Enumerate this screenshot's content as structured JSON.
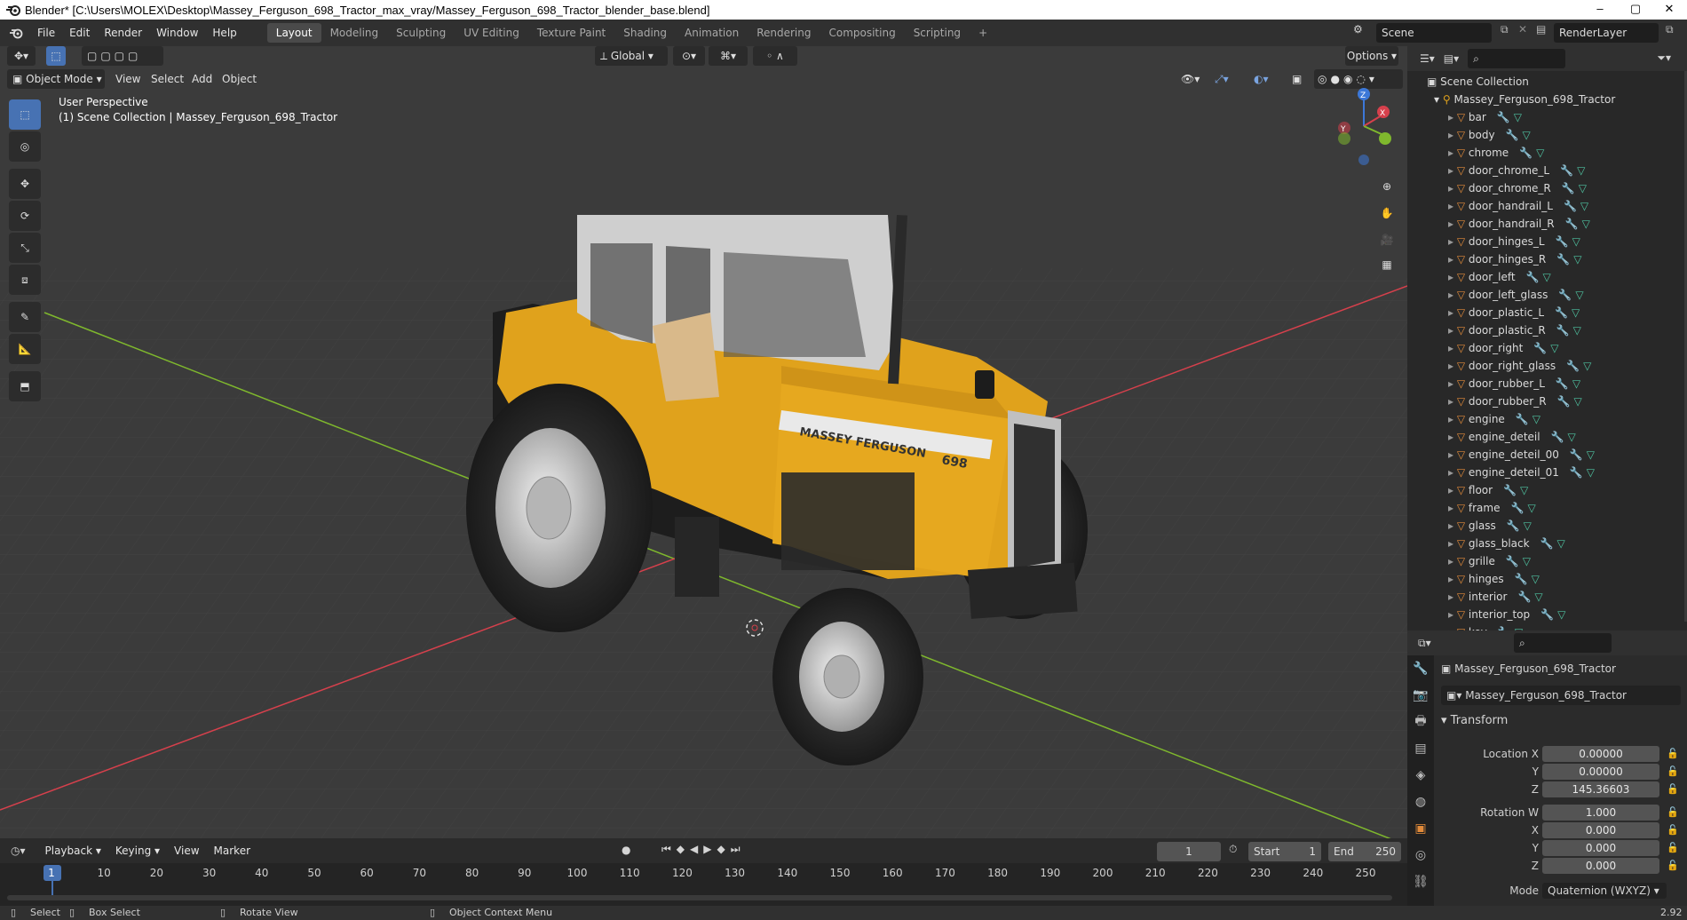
{
  "window": {
    "title": "Blender* [C:\\Users\\MOLEX\\Desktop\\Massey_Ferguson_698_Tractor_max_vray/Massey_Ferguson_698_Tractor_blender_base.blend]",
    "min": "–",
    "max": "▢",
    "close": "✕"
  },
  "topbar": {
    "menus": [
      "File",
      "Edit",
      "Render",
      "Window",
      "Help"
    ],
    "workspaces": [
      "Layout",
      "Modeling",
      "Sculpting",
      "UV Editing",
      "Texture Paint",
      "Shading",
      "Animation",
      "Rendering",
      "Compositing",
      "Scripting"
    ],
    "add_tab": "+",
    "scene": "Scene",
    "render_layer": "RenderLayer"
  },
  "viewport": {
    "mode": "Object Mode",
    "menus": [
      "View",
      "Select",
      "Add",
      "Object"
    ],
    "transform_orientation": "Global",
    "options": "Options",
    "info_line1": "User Perspective",
    "info_line2": "(1) Scene Collection | Massey_Ferguson_698_Tractor",
    "gizmo_x": "X",
    "gizmo_y": "Y",
    "gizmo_z": "Z",
    "branding": {
      "brand": "MASSEY FERGUSON",
      "model": "698"
    }
  },
  "timeline": {
    "menus": [
      "Playback",
      "Keying",
      "View",
      "Marker"
    ],
    "current_frame": "1",
    "start_label": "Start",
    "start": "1",
    "end_label": "End",
    "end": "250",
    "ticks": [
      "1",
      "10",
      "20",
      "30",
      "40",
      "50",
      "60",
      "70",
      "80",
      "90",
      "100",
      "110",
      "120",
      "130",
      "140",
      "150",
      "160",
      "170",
      "180",
      "190",
      "200",
      "210",
      "220",
      "230",
      "240",
      "250"
    ]
  },
  "statusbar": {
    "select": "Select",
    "box_select": "Box Select",
    "rotate_view": "Rotate View",
    "context_menu": "Object Context Menu",
    "version": "2.92"
  },
  "outliner": {
    "root": "Scene Collection",
    "collection": "Massey_Ferguson_698_Tractor",
    "items": [
      "bar",
      "body",
      "chrome",
      "door_chrome_L",
      "door_chrome_R",
      "door_handrail_L",
      "door_handrail_R",
      "door_hinges_L",
      "door_hinges_R",
      "door_left",
      "door_left_glass",
      "door_plastic_L",
      "door_plastic_R",
      "door_right",
      "door_right_glass",
      "door_rubber_L",
      "door_rubber_R",
      "engine",
      "engine_deteil",
      "engine_deteil_00",
      "engine_deteil_01",
      "floor",
      "frame",
      "glass",
      "glass_black",
      "grille",
      "hinges",
      "interior",
      "interior_top",
      "key"
    ]
  },
  "properties": {
    "object_name": "Massey_Ferguson_698_Tractor",
    "data_name": "Massey_Ferguson_698_Tractor",
    "section": "Transform",
    "location_label": "Location X",
    "location": {
      "x": "0.00000",
      "y": "0.00000",
      "z": "145.36603"
    },
    "rotation_label": "Rotation W",
    "rotation": {
      "w": "1.000",
      "x": "0.000",
      "y": "0.000",
      "z": "0.000"
    },
    "axis_y": "Y",
    "axis_z": "Z",
    "axis_x": "X",
    "mode_label": "Mode",
    "mode": "Quaternion (WXYZ)"
  },
  "colors": {
    "accent": "#4772b3",
    "tractor_yellow": "#e0a21c",
    "x_axis": "#d6404c",
    "y_axis": "#7fb82d"
  }
}
